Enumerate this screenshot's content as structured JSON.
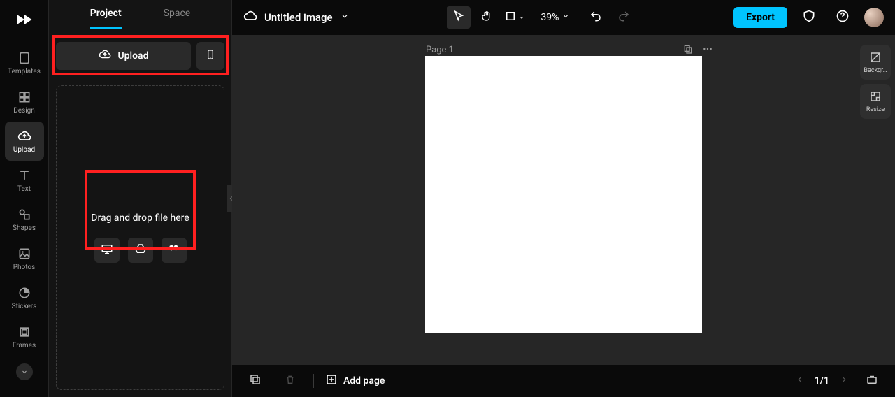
{
  "nav": {
    "items": [
      {
        "label": "Templates"
      },
      {
        "label": "Design"
      },
      {
        "label": "Upload"
      },
      {
        "label": "Text"
      },
      {
        "label": "Shapes"
      },
      {
        "label": "Photos"
      },
      {
        "label": "Stickers"
      },
      {
        "label": "Frames"
      }
    ]
  },
  "panel": {
    "tabs": {
      "project": "Project",
      "space": "Space"
    },
    "upload_label": "Upload",
    "drop_text": "Drag and drop file here"
  },
  "header": {
    "title": "Untitled image",
    "zoom": "39%",
    "export": "Export"
  },
  "canvas": {
    "page_label": "Page 1"
  },
  "right_rail": {
    "background": "Backgr…",
    "resize": "Resize"
  },
  "bottom": {
    "add_page": "Add page",
    "pager": "1/1"
  },
  "colors": {
    "accent": "#00c4ff",
    "highlight": "#ff2020"
  }
}
